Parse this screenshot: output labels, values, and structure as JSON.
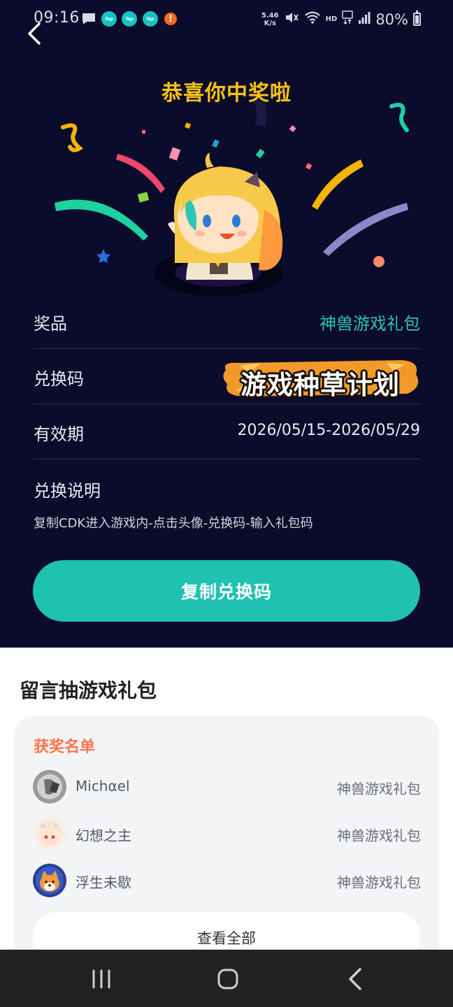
{
  "status_bar": {
    "time": "09:16",
    "app_icon_label": "Tap",
    "alert_glyph": "!",
    "net_speed_value": "5.46",
    "net_speed_unit": "K/s",
    "hd_label": "HD",
    "battery": "80%",
    "icons": [
      "message-icon",
      "taptap-icon",
      "taptap-icon",
      "taptap-icon",
      "alert-icon",
      "mute-icon",
      "wifi-icon",
      "5g-icon",
      "signal-icon",
      "battery-icon"
    ]
  },
  "header": {
    "headline": "恭喜你中奖啦",
    "back_icon": "chevron-left-icon"
  },
  "details": {
    "prize_label": "奖品",
    "prize_value": "神兽游戏礼包",
    "code_label": "兑换码",
    "code_value": "游戏种草计划",
    "validity_label": "有效期",
    "validity_value": "2026/05/15-2026/05/29",
    "instructions_title": "兑换说明",
    "instructions_body": "复制CDK进入游戏内-点击头像-兑换码-输入礼包码"
  },
  "actions": {
    "copy_button": "复制兑换码"
  },
  "sheet": {
    "title": "留言抽游戏礼包",
    "winners_title": "获奖名单",
    "winners": [
      {
        "name": "Michαel",
        "prize": "神兽游戏礼包"
      },
      {
        "name": "幻想之主",
        "prize": "神兽游戏礼包"
      },
      {
        "name": "浮生未歇",
        "prize": "神兽游戏礼包"
      }
    ],
    "view_all": "查看全部"
  },
  "colors": {
    "background": "#0b0b2b",
    "accent_teal": "#1fc1b1",
    "headline_yellow": "#f7c313",
    "winners_orange": "#ff7448"
  }
}
